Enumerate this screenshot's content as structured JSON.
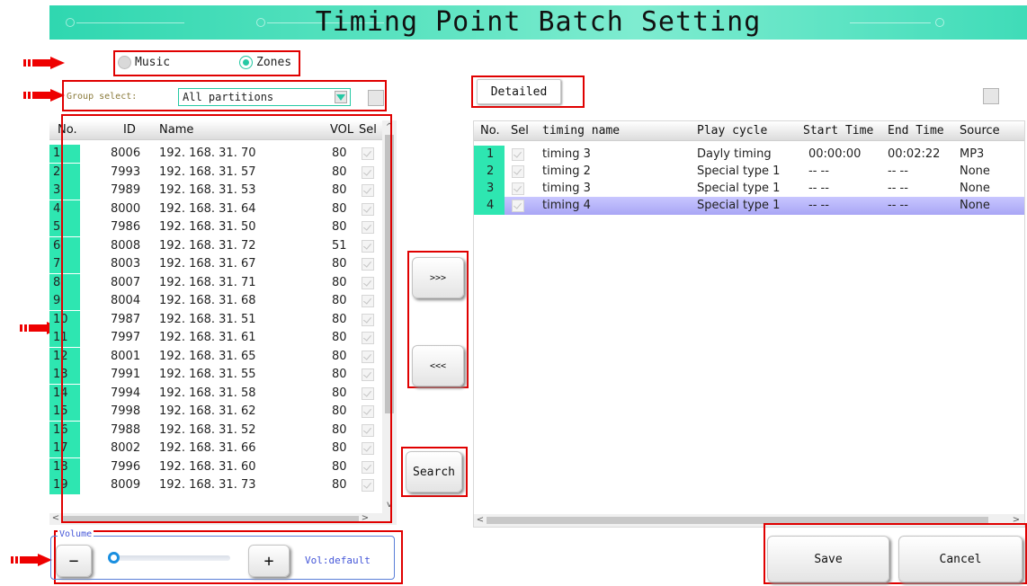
{
  "header": {
    "title": "Timing Point Batch Setting"
  },
  "mode": {
    "options": [
      {
        "label": "Music",
        "selected": false
      },
      {
        "label": "Zones",
        "selected": true
      }
    ]
  },
  "group_select": {
    "label": "Group select:",
    "value": "All partitions"
  },
  "left_table": {
    "columns": [
      "No.",
      "ID",
      "Name",
      "VOL",
      "Sel"
    ],
    "rows": [
      {
        "no": "1",
        "id": "8006",
        "name": "192. 168. 31. 70",
        "vol": "80"
      },
      {
        "no": "2",
        "id": "7993",
        "name": "192. 168. 31. 57",
        "vol": "80"
      },
      {
        "no": "3",
        "id": "7989",
        "name": "192. 168. 31. 53",
        "vol": "80"
      },
      {
        "no": "4",
        "id": "8000",
        "name": "192. 168. 31. 64",
        "vol": "80"
      },
      {
        "no": "5",
        "id": "7986",
        "name": "192. 168. 31. 50",
        "vol": "80"
      },
      {
        "no": "6",
        "id": "8008",
        "name": "192. 168. 31. 72",
        "vol": "51"
      },
      {
        "no": "7",
        "id": "8003",
        "name": "192. 168. 31. 67",
        "vol": "80"
      },
      {
        "no": "8",
        "id": "8007",
        "name": "192. 168. 31. 71",
        "vol": "80"
      },
      {
        "no": "9",
        "id": "8004",
        "name": "192. 168. 31. 68",
        "vol": "80"
      },
      {
        "no": "10",
        "id": "7987",
        "name": "192. 168. 31. 51",
        "vol": "80"
      },
      {
        "no": "11",
        "id": "7997",
        "name": "192. 168. 31. 61",
        "vol": "80"
      },
      {
        "no": "12",
        "id": "8001",
        "name": "192. 168. 31. 65",
        "vol": "80"
      },
      {
        "no": "13",
        "id": "7991",
        "name": "192. 168. 31. 55",
        "vol": "80"
      },
      {
        "no": "14",
        "id": "7994",
        "name": "192. 168. 31. 58",
        "vol": "80"
      },
      {
        "no": "15",
        "id": "7998",
        "name": "192. 168. 31. 62",
        "vol": "80"
      },
      {
        "no": "16",
        "id": "7988",
        "name": "192. 168. 31. 52",
        "vol": "80"
      },
      {
        "no": "17",
        "id": "8002",
        "name": "192. 168. 31. 66",
        "vol": "80"
      },
      {
        "no": "18",
        "id": "7996",
        "name": "192. 168. 31. 60",
        "vol": "80"
      },
      {
        "no": "19",
        "id": "8009",
        "name": "192. 168. 31. 73",
        "vol": "80"
      }
    ]
  },
  "transfer": {
    "add_label": ">>>",
    "remove_label": "<<<",
    "search_label": "Search"
  },
  "detailed_button": {
    "label": "Detailed"
  },
  "right_table": {
    "columns": [
      "No.",
      "Sel",
      "timing name",
      "Play cycle",
      "Start Time",
      "End Time",
      "Source"
    ],
    "rows": [
      {
        "no": "1",
        "name": "timing 3",
        "cycle": "Dayly timing",
        "start": "00:00:00",
        "end": "00:02:22",
        "source": "MP3",
        "selected": false
      },
      {
        "no": "2",
        "name": "timing 2",
        "cycle": "Special type 1",
        "start": "-- --",
        "end": "-- --",
        "source": "None",
        "selected": false
      },
      {
        "no": "3",
        "name": "timing 3",
        "cycle": "Special type 1",
        "start": "-- --",
        "end": "-- --",
        "source": "None",
        "selected": false
      },
      {
        "no": "4",
        "name": "timing 4",
        "cycle": "Special type 1",
        "start": "-- --",
        "end": "-- --",
        "source": "None",
        "selected": true
      }
    ]
  },
  "volume": {
    "legend": "Volume",
    "minus_label": "−",
    "plus_label": "+",
    "status": "Vol:default",
    "level_fraction": 0.0
  },
  "actions": {
    "save_label": "Save",
    "cancel_label": "Cancel"
  },
  "colors": {
    "accent": "#2ee6b1",
    "highlight": "#e00000",
    "selected_row": "#a9a6f5"
  }
}
